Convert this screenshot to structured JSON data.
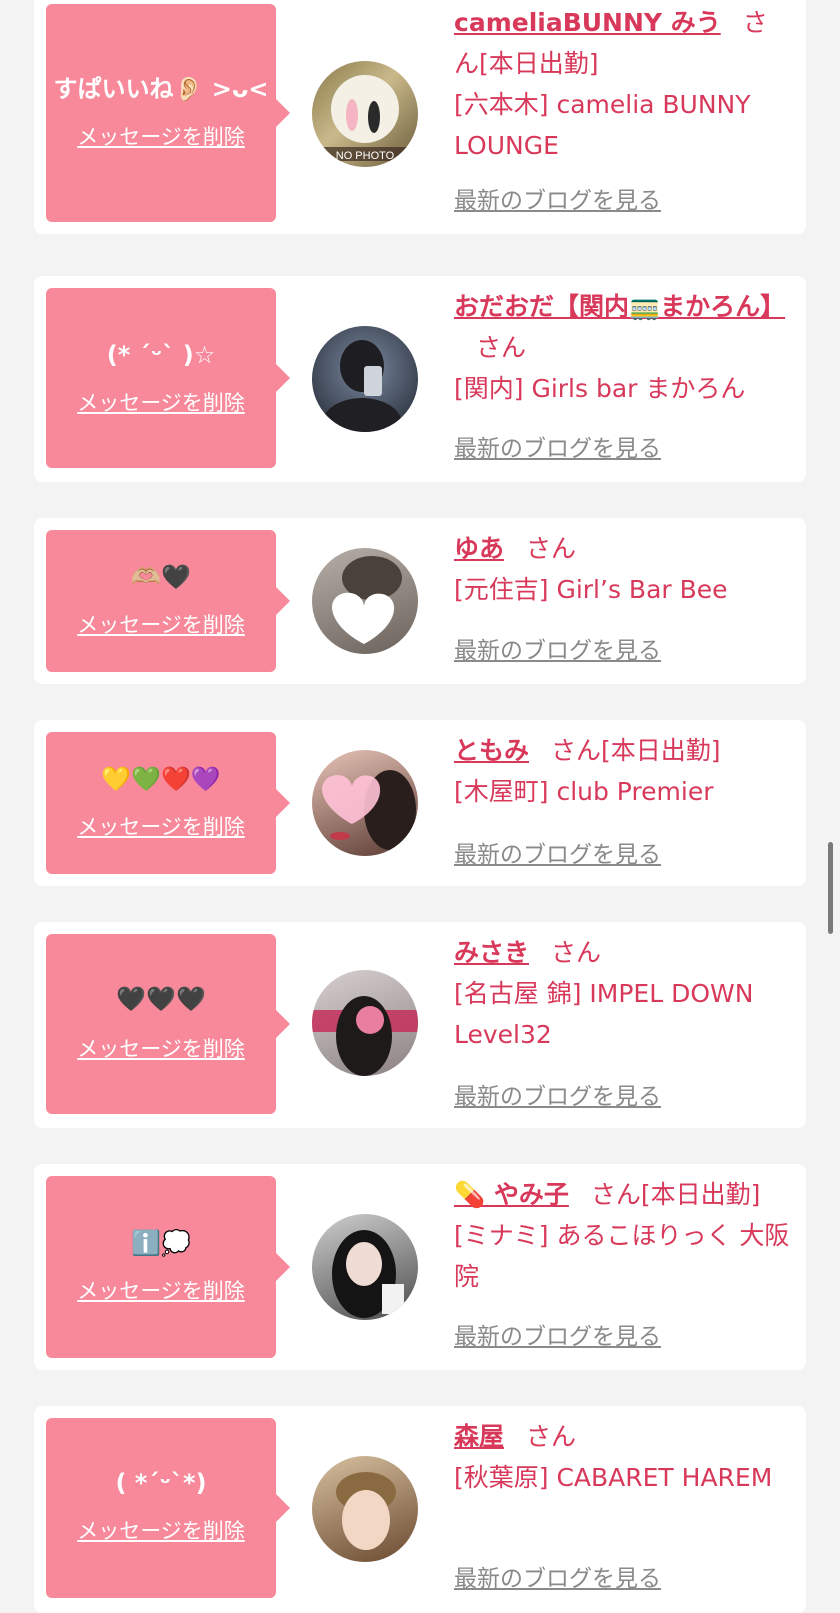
{
  "delete_label": "メッセージを削除",
  "blog_label": "最新のブログを見る",
  "san": "さん",
  "accent_color": "#d8385a",
  "bubble_color": "#f7899a",
  "cards": [
    {
      "message": "すぱいいね👂🏻 >ᴗ<",
      "name": "cameliaBUNNY みう",
      "attendance": "[本日出勤]",
      "area_shop": "[六本木] camelia BUNNY LOUNGE",
      "avatar": "camelia-bunny-lounge-logo"
    },
    {
      "message": "(* ˊᵕˋ )☆",
      "name": "おだおだ【関内🚃まかろん】",
      "attendance": "",
      "area_shop": "[関内] Girls bar まかろん",
      "avatar": "person-photo"
    },
    {
      "message": "🫶🏼🖤",
      "name": "ゆあ",
      "attendance": "",
      "area_shop": "[元住吉] Girl’s Bar Bee",
      "avatar": "person-photo"
    },
    {
      "message": "💛💚❤️💜",
      "name": "ともみ",
      "attendance": "[本日出勤]",
      "area_shop": "[木屋町] club Premier",
      "avatar": "person-photo"
    },
    {
      "message": "🖤🖤🖤",
      "name": "みさき",
      "attendance": "",
      "area_shop": "[名古屋 錦] IMPEL DOWN Level32",
      "avatar": "person-photo"
    },
    {
      "message": "ℹ️💭",
      "name": "💊 やみ子",
      "attendance": "[本日出勤]",
      "area_shop": "[ミナミ] あるこほりっく 大阪院",
      "avatar": "person-photo"
    },
    {
      "message": "( *ˊᵕˋ*)",
      "name": "森屋",
      "attendance": "",
      "area_shop": "[秋葉原] CABARET HAREM",
      "avatar": "person-photo"
    }
  ]
}
